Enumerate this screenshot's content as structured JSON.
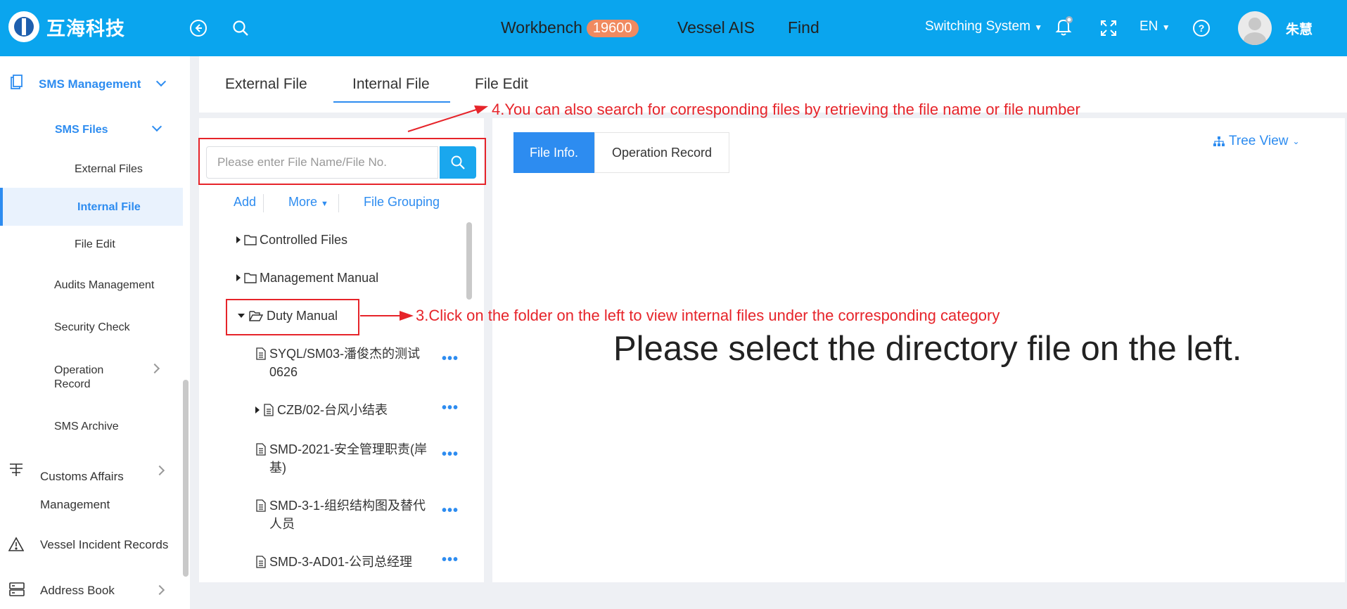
{
  "header": {
    "logo_text": "互海科技",
    "nav": [
      {
        "label": "Workbench",
        "badge": "19600"
      },
      {
        "label": "Vessel AIS"
      },
      {
        "label": "Find"
      }
    ],
    "switching_system": "Switching System",
    "language": "EN",
    "user_name": "朱慧"
  },
  "sidebar": {
    "items": [
      {
        "label": "SMS Management"
      },
      {
        "label": "SMS Files"
      },
      {
        "label": "External Files"
      },
      {
        "label": "Internal File"
      },
      {
        "label": "File Edit"
      },
      {
        "label": "Audits Management"
      },
      {
        "label": "Security Check"
      },
      {
        "label": "Operation Record"
      },
      {
        "label": "SMS Archive"
      },
      {
        "label": "Customs Affairs Management"
      },
      {
        "label": "Vessel Incident Records"
      },
      {
        "label": "Address Book"
      }
    ]
  },
  "top_tabs": [
    "External File",
    "Internal File",
    "File Edit"
  ],
  "active_top_tab": "Internal File",
  "left_panel": {
    "search_placeholder": "Please enter File Name/File No.",
    "toolbar": {
      "add": "Add",
      "more": "More",
      "grouping": "File Grouping"
    },
    "tree": [
      {
        "label": "Controlled Files"
      },
      {
        "label": "Management Manual"
      },
      {
        "label": "Duty Manual"
      },
      {
        "label": "SYQL/SM03-潘俊杰的测试0626"
      },
      {
        "label": "CZB/02-台风小结表"
      },
      {
        "label": "SMD-2021-安全管理职责(岸基)"
      },
      {
        "label": "SMD-3-1-组织结构图及替代人员"
      },
      {
        "label": "SMD-3-AD01-公司总经理"
      }
    ]
  },
  "right_panel": {
    "tabs": [
      "File Info.",
      "Operation Record"
    ],
    "tree_view": "Tree View",
    "empty_message": "Please select the directory file on the left."
  },
  "annotations": {
    "step4": "4.You can also search for corresponding files by retrieving the file name or file number",
    "step3": "3.Click on the folder on the left to view internal files under the corresponding category"
  },
  "colors": {
    "header": "#0aa5ee",
    "accent": "#2d8cf0",
    "annotation": "#e6242a",
    "badge": "#f08a60"
  }
}
